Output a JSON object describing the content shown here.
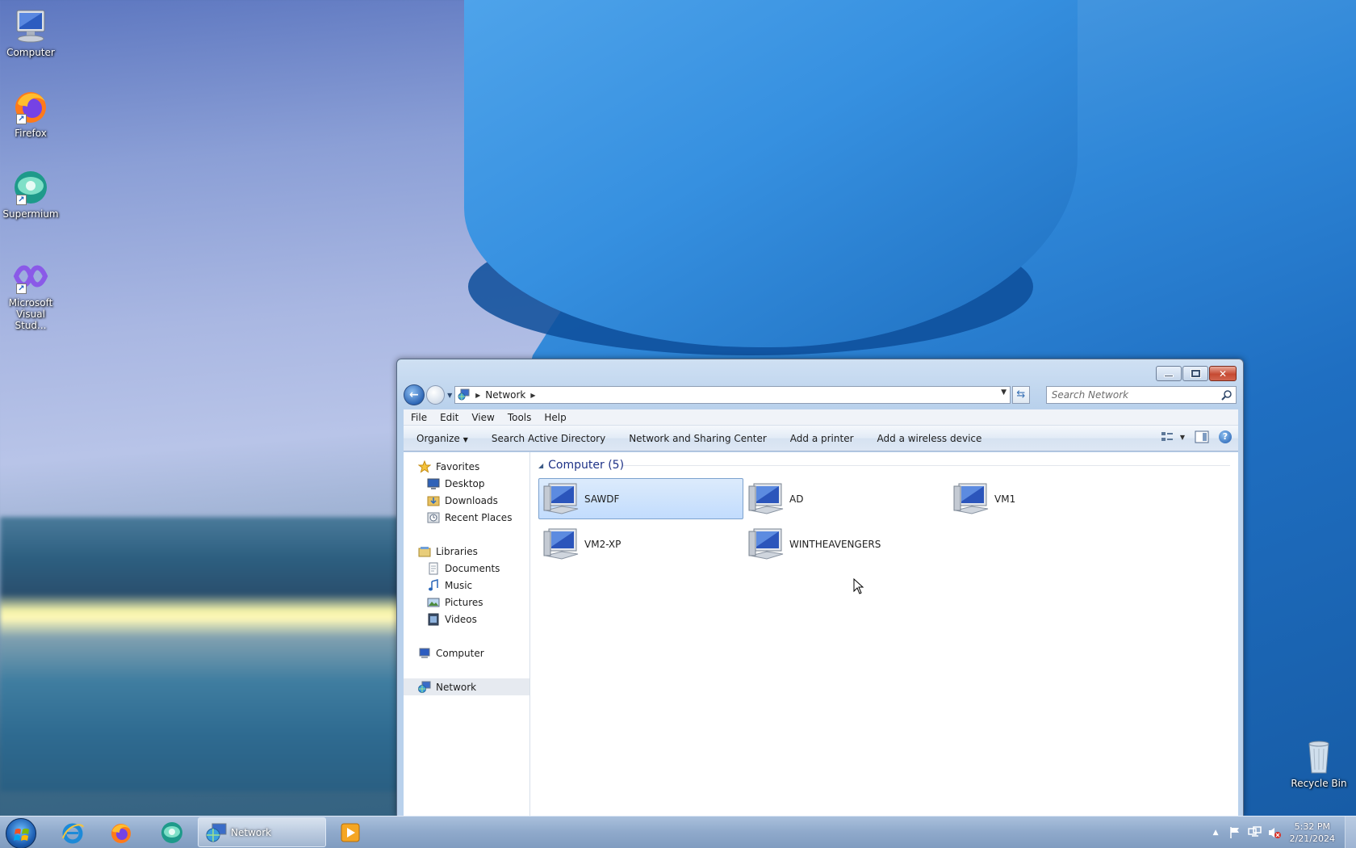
{
  "desktop": {
    "icons": [
      {
        "label": "Computer"
      },
      {
        "label": "Firefox"
      },
      {
        "label": "Supermium"
      },
      {
        "label": "Microsoft Visual Stud..."
      },
      {
        "label": "Recycle Bin"
      }
    ]
  },
  "window": {
    "address": {
      "crumb": "Network"
    },
    "search": {
      "placeholder": "Search Network"
    },
    "menu": {
      "file": "File",
      "edit": "Edit",
      "view": "View",
      "tools": "Tools",
      "help": "Help"
    },
    "commands": {
      "organize": "Organize",
      "search_ad": "Search Active Directory",
      "network_sharing": "Network and Sharing Center",
      "add_printer": "Add a printer",
      "add_wireless": "Add a wireless device"
    },
    "nav": {
      "favorites": "Favorites",
      "desktop": "Desktop",
      "downloads": "Downloads",
      "recent_places": "Recent Places",
      "libraries": "Libraries",
      "documents": "Documents",
      "music": "Music",
      "pictures": "Pictures",
      "videos": "Videos",
      "computer": "Computer",
      "network": "Network"
    },
    "group": {
      "title": "Computer (5)"
    },
    "items": [
      "SAWDF",
      "AD",
      "VM1",
      "VM2-XP",
      "WINTHEAVENGERS"
    ]
  },
  "taskbar": {
    "task_label": "Network",
    "time": "5:32 PM",
    "date": "2/21/2024"
  },
  "colors": {
    "accent": "#1e3287",
    "selection": "#c2dcfd",
    "close": "#c64a32"
  }
}
